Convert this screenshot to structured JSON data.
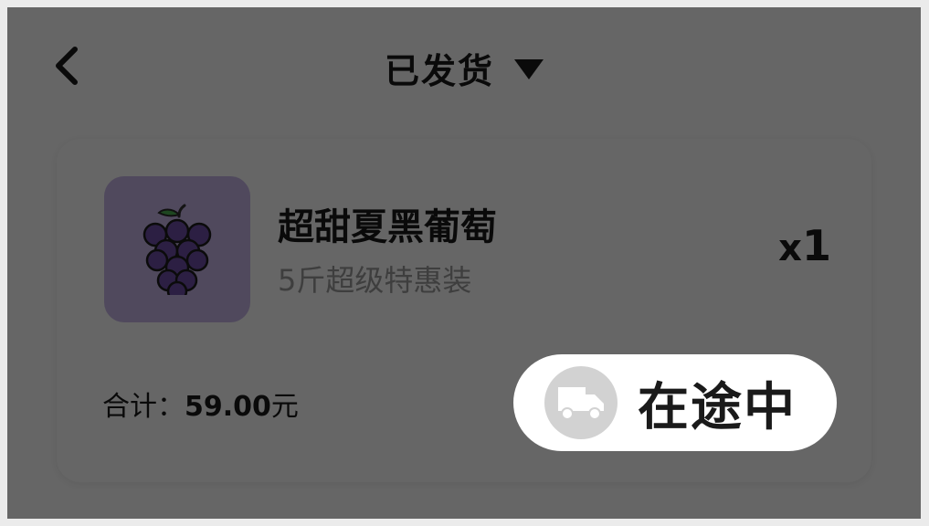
{
  "header": {
    "title": "已发货",
    "back_icon": "chevron-left-icon",
    "dropdown_icon": "caret-down-icon"
  },
  "order": {
    "product_name": "超甜夏黑葡萄",
    "product_spec": "5斤超级特惠装",
    "quantity_prefix": "x",
    "quantity": "1",
    "total_label": "合计：",
    "total_amount": "59.00",
    "currency": "元",
    "product_icon": "grapes-icon",
    "thumb_color": "#c7b7e8"
  },
  "status": {
    "label": "在途中",
    "icon": "truck-icon"
  },
  "colors": {
    "overlay": "rgba(0,0,0,0.6)",
    "text_primary": "#1a1a1a",
    "text_secondary": "#9b9b9b",
    "grape_purple": "#6f4fa8"
  }
}
